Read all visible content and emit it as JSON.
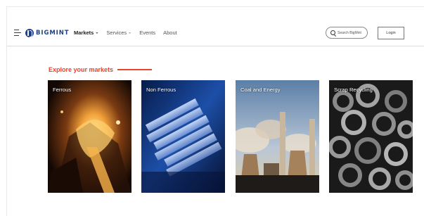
{
  "header": {
    "logo_text": "BIGMINT",
    "nav": [
      {
        "label": "Markets",
        "has_dropdown": true
      },
      {
        "label": "Services",
        "has_dropdown": true
      },
      {
        "label": "Events",
        "has_dropdown": false
      },
      {
        "label": "About",
        "has_dropdown": false
      }
    ],
    "search_placeholder": "Search BigMint",
    "login_label": "Login"
  },
  "main": {
    "section_title": "Explore your markets",
    "cards": [
      {
        "label": "Ferrous"
      },
      {
        "label": "Non Ferrous"
      },
      {
        "label": "Coal and Energy"
      },
      {
        "label": "Scrap Recycling"
      }
    ]
  },
  "colors": {
    "brand": "#1d3f8f",
    "accent": "#e8432d"
  },
  "icons": [
    "hamburger-menu-icon",
    "bigmint-logo-icon",
    "chevron-down-icon",
    "search-icon"
  ]
}
